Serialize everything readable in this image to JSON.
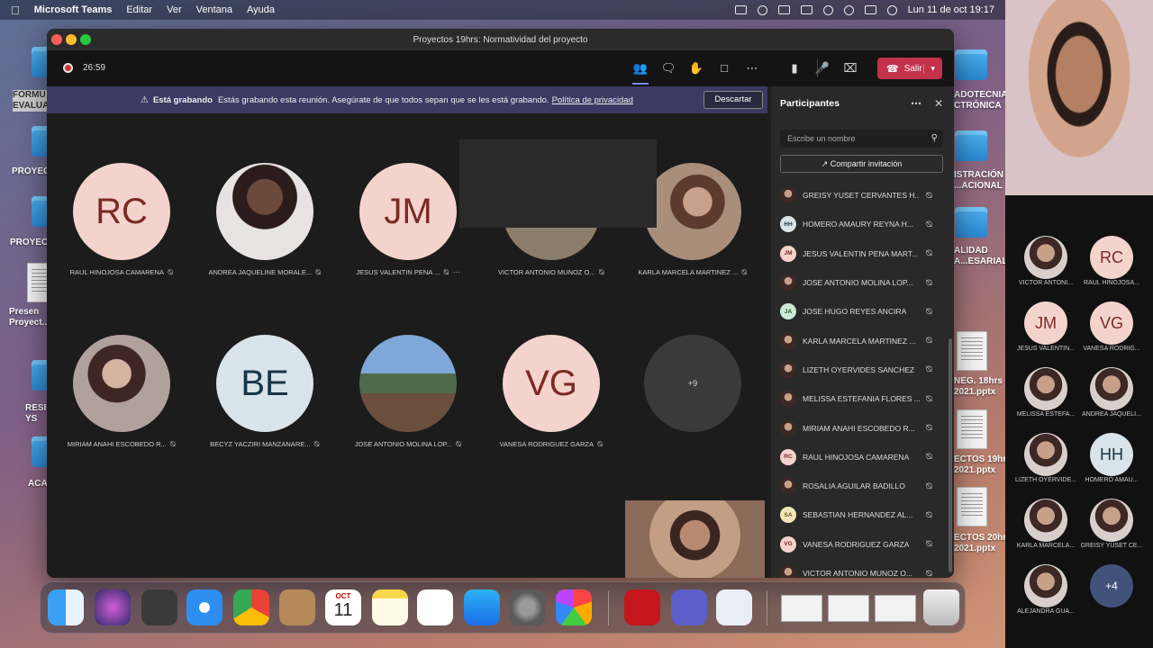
{
  "menubar": {
    "app": "Microsoft Teams",
    "menus": [
      "Editar",
      "Ver",
      "Ventana",
      "Ayuda"
    ],
    "datetime": "Lun 11 de oct  19:17"
  },
  "desktop": {
    "left_labels": [
      "FORMU\nEVALUA",
      "PROYEC",
      "PROYECT",
      "Presen\nProyect...",
      "RESI\nYS",
      "ACA"
    ],
    "right_labels": [
      "ADOTECNIA\nCTRÓNICA",
      "ISTRACIÓN\n...ACIONAL",
      "ALIDAD\nA...ESARIAL",
      "NEG. 18hrs\n2021.pptx",
      "ECTOS 19hrs\n2021.pptx",
      "ECTOS 20hrs\n2021.pptx"
    ]
  },
  "window": {
    "title": "Proyectos 19hrs: Normatividad del proyecto"
  },
  "toolbar": {
    "timer": "26:59",
    "leave_label": "Salir"
  },
  "banner": {
    "bold": "Está grabando",
    "text": "Estás grabando esta reunión. Asegúrate de que todos sepan que se les está grabando.",
    "link": "Política de privacidad",
    "button": "Descartar"
  },
  "tiles": [
    {
      "initials": "RC",
      "name": "RAUL HINOJOSA CAMARENA"
    },
    {
      "initials": "",
      "name": "ANDREA JAQUELINE MORALE..."
    },
    {
      "initials": "JM",
      "name": "JESUS VALENTIN PENA ..."
    },
    {
      "initials": "",
      "name": "VICTOR ANTONIO MUNOZ O..."
    },
    {
      "initials": "",
      "name": "KARLA MARCELA MARTINEZ ..."
    },
    {
      "initials": "",
      "name": "MIRIAM ANAHI ESCOBEDO R..."
    },
    {
      "initials": "BE",
      "name": "BECYZ YACZIRI MANZANARE..."
    },
    {
      "initials": "",
      "name": "JOSE ANTONIO MOLINA LOP..."
    },
    {
      "initials": "VG",
      "name": "VANESA RODRIGUEZ GARZA"
    },
    {
      "initials": "+9",
      "name": ""
    }
  ],
  "panel": {
    "title": "Participantes",
    "search_placeholder": "Escribe un nombre",
    "share_label": "Compartir invitación",
    "participants": [
      {
        "name": "GREISY YUSET CERVANTES H...",
        "initials": ""
      },
      {
        "name": "HOMERO AMAURY REYNA H...",
        "initials": "HH"
      },
      {
        "name": "JESUS VALENTIN PENA MART...",
        "initials": "JM"
      },
      {
        "name": "JOSE ANTONIO MOLINA LOP...",
        "initials": ""
      },
      {
        "name": "JOSE HUGO REYES ANCIRA",
        "initials": "JA"
      },
      {
        "name": "KARLA MARCELA MARTINEZ ...",
        "initials": ""
      },
      {
        "name": "LIZETH OYERVIDES SANCHEZ",
        "initials": ""
      },
      {
        "name": "MELISSA ESTEFANIA FLORES ...",
        "initials": ""
      },
      {
        "name": "MIRIAM ANAHI ESCOBEDO R...",
        "initials": ""
      },
      {
        "name": "RAUL HINOJOSA CAMARENA",
        "initials": "RC"
      },
      {
        "name": "ROSALIA AGUILAR BADILLO",
        "initials": ""
      },
      {
        "name": "SEBASTIAN HERNANDEZ AL...",
        "initials": "SA"
      },
      {
        "name": "VANESA RODRIGUEZ GARZA",
        "initials": "VG"
      },
      {
        "name": "VICTOR ANTONIO MUNOZ O...",
        "initials": ""
      }
    ]
  },
  "dock": {
    "calendar_month": "OCT",
    "calendar_day": "11"
  },
  "side_gallery": [
    {
      "initials": "",
      "name": "VICTOR ANTONI..."
    },
    {
      "initials": "RC",
      "name": "RAUL HINOJOSA..."
    },
    {
      "initials": "JM",
      "name": "JESUS VALENTIN..."
    },
    {
      "initials": "VG",
      "name": "VANESA RODRIG..."
    },
    {
      "initials": "",
      "name": "MELISSA ESTEFA..."
    },
    {
      "initials": "",
      "name": "ANDREA JAQUELI..."
    },
    {
      "initials": "",
      "name": "LIZETH OYERVIDE..."
    },
    {
      "initials": "HH",
      "name": "HOMERO AMAU..."
    },
    {
      "initials": "",
      "name": "KARLA MARCELA..."
    },
    {
      "initials": "",
      "name": "GREISY YUSET CE..."
    },
    {
      "initials": "",
      "name": "ALEJANDRA GUA..."
    },
    {
      "initials": "+4",
      "name": ""
    }
  ]
}
